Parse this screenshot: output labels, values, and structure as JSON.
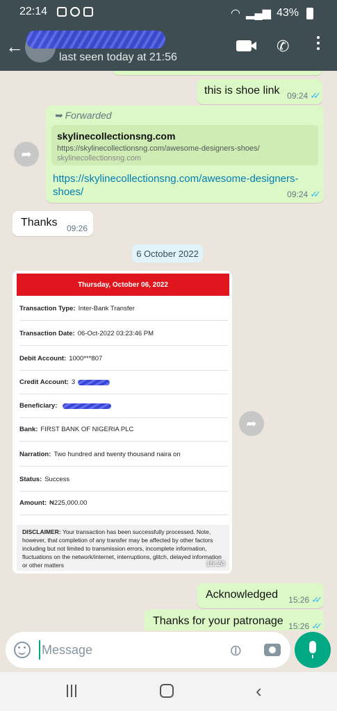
{
  "status_bar": {
    "time": "22:14",
    "battery": "43%"
  },
  "header": {
    "last_seen": "last seen today at 21:56"
  },
  "messages": {
    "shoe_link": {
      "text": "this is shoe link",
      "time": "09:24"
    },
    "forwarded": {
      "label": "Forwarded",
      "preview_title": "skylinecollectionsng.com",
      "preview_url": "https://skylinecollectionsng.com/awesome-designers-shoes/",
      "preview_domain": "skylinecollectionsng.com",
      "link": "https://skylinecollectionsng.com/awesome-designers-shoes/",
      "time": "09:24"
    },
    "thanks": {
      "text": "Thanks",
      "time": "09:26"
    },
    "date_divider": "6 October 2022",
    "receipt": {
      "header": "Thursday, October 06, 2022",
      "rows": [
        {
          "label": "Transaction Type:",
          "value": "Inter-Bank Transfer"
        },
        {
          "label": "Transaction Date:",
          "value": "06-Oct-2022 03:23:46 PM"
        },
        {
          "label": "Debit Account:",
          "value": "1000***807"
        },
        {
          "label": "Credit Account:",
          "value": "3"
        },
        {
          "label": "Beneficiary:",
          "value": ""
        },
        {
          "label": "Bank:",
          "value": "FIRST BANK OF NIGERIA PLC"
        },
        {
          "label": "Narration:",
          "value": "Two hundred and twenty thousand naira on"
        },
        {
          "label": "Status:",
          "value": "Success"
        },
        {
          "label": "Amount:",
          "value": "₦225,000.00"
        }
      ],
      "disclaimer_title": "DISCLAIMER:",
      "disclaimer_text": "Your transaction has been successfully processed. Note, however, that completion of any transfer may be affected by other factors including but not limited to transmission errors, incomplete information, fluctuations on the network/internet, interruptions, glitch, delayed information or other matters",
      "time": "15:24"
    },
    "acknowledged": {
      "text": "Acknowledged",
      "time": "15:26"
    },
    "patronage": {
      "text": "Thanks for your patronage",
      "time": "15:26"
    }
  },
  "input": {
    "placeholder": "Message"
  },
  "colors": {
    "header": "#3d4d52",
    "outgoing": "#dcf8c6",
    "incoming": "#ffffff",
    "accent": "#00a884",
    "receipt_red": "#e0161f",
    "read_ticks": "#34b7f1"
  },
  "icons": [
    "back-arrow-icon",
    "video-call-icon",
    "phone-icon",
    "menu-dots-icon",
    "share-icon",
    "forward-icon",
    "emoji-icon",
    "attach-icon",
    "camera-icon",
    "mic-icon"
  ]
}
